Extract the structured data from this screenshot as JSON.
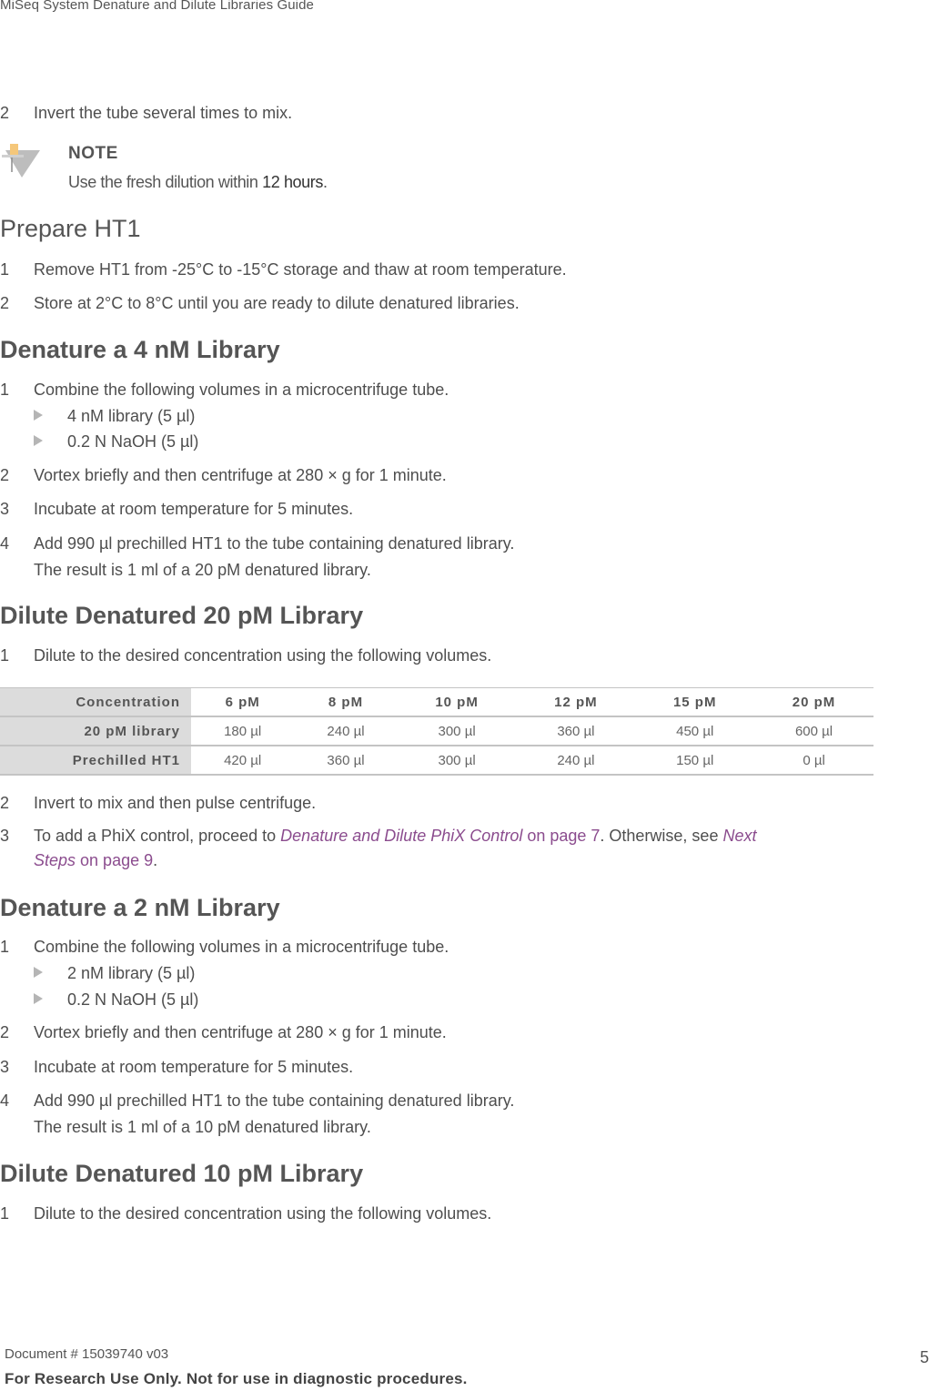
{
  "header": {
    "title": "MiSeq System Denature and Dilute Libraries Guide"
  },
  "intro_step": {
    "num": "2",
    "text": "Invert the tube several times to mix."
  },
  "note": {
    "icon": "pushpin-note-icon",
    "title": "NOTE",
    "text_pre": "Use the fresh dilution within ",
    "text_bold": "12 hours",
    "text_post": "."
  },
  "prepare_ht1": {
    "heading": "Prepare HT1",
    "steps": [
      {
        "num": "1",
        "text": "Remove HT1 from -25°C to -15°C storage and thaw at room temperature."
      },
      {
        "num": "2",
        "text": "Store at 2°C to 8°C until you are ready to dilute denatured libraries."
      }
    ]
  },
  "denature_4nm": {
    "heading": "Denature a 4 nM Library",
    "step1": {
      "num": "1",
      "text": "Combine the following volumes in a microcentrifuge tube."
    },
    "bullets": [
      "4 nM library (5 µl)",
      "0.2 N NaOH (5 µl)"
    ],
    "steps": [
      {
        "num": "2",
        "text": "Vortex briefly and then centrifuge at 280 × g for 1 minute."
      },
      {
        "num": "3",
        "text": "Incubate at room temperature for 5 minutes."
      },
      {
        "num": "4",
        "text": "Add 990 µl prechilled HT1 to the tube containing denatured library."
      }
    ],
    "result": "The result is 1 ml of a 20 pM denatured library."
  },
  "dilute_20pm": {
    "heading": "Dilute Denatured 20 pM Library",
    "step1": {
      "num": "1",
      "text": "Dilute to the desired concentration using the following volumes."
    },
    "table": {
      "row_headers": [
        "Concentration",
        "20 pM library",
        "Prechilled HT1"
      ],
      "columns": [
        "6 pM",
        "8 pM",
        "10 pM",
        "12 pM",
        "15 pM",
        "20 pM"
      ],
      "library": [
        "180 µl",
        "240 µl",
        "300 µl",
        "360 µl",
        "450 µl",
        "600 µl"
      ],
      "ht1": [
        "420 µl",
        "360 µl",
        "300 µl",
        "240 µl",
        "150 µl",
        "0 µl"
      ]
    },
    "step2": {
      "num": "2",
      "text": "Invert to mix and then pulse centrifuge."
    },
    "step3": {
      "num": "3",
      "pre": "To add a PhiX control, proceed to ",
      "link1_italic": "Denature and Dilute PhiX Control",
      "link1_rest": " on page 7",
      "mid": ". Otherwise, see ",
      "link2_italic_a": "Next",
      "link2_italic_b": "Steps",
      "link2_rest": " on page 9",
      "post": "."
    }
  },
  "denature_2nm": {
    "heading": "Denature a 2 nM Library",
    "step1": {
      "num": "1",
      "text": "Combine the following volumes in a microcentrifuge tube."
    },
    "bullets": [
      "2 nM library (5 µl)",
      "0.2 N NaOH (5 µl)"
    ],
    "steps": [
      {
        "num": "2",
        "text": "Vortex briefly and then centrifuge at 280 × g for 1 minute."
      },
      {
        "num": "3",
        "text": "Incubate at room temperature for 5 minutes."
      },
      {
        "num": "4",
        "text": "Add 990 µl prechilled HT1 to the tube containing denatured library."
      }
    ],
    "result": "The result is 1 ml of a 10 pM denatured library."
  },
  "dilute_10pm": {
    "heading": "Dilute Denatured 10 pM Library",
    "step1": {
      "num": "1",
      "text": "Dilute to the desired concentration using the following volumes."
    }
  },
  "footer": {
    "document": "Document # 15039740 v03",
    "page": "5",
    "disclaimer": "For Research Use Only. Not for use in diagnostic procedures."
  }
}
